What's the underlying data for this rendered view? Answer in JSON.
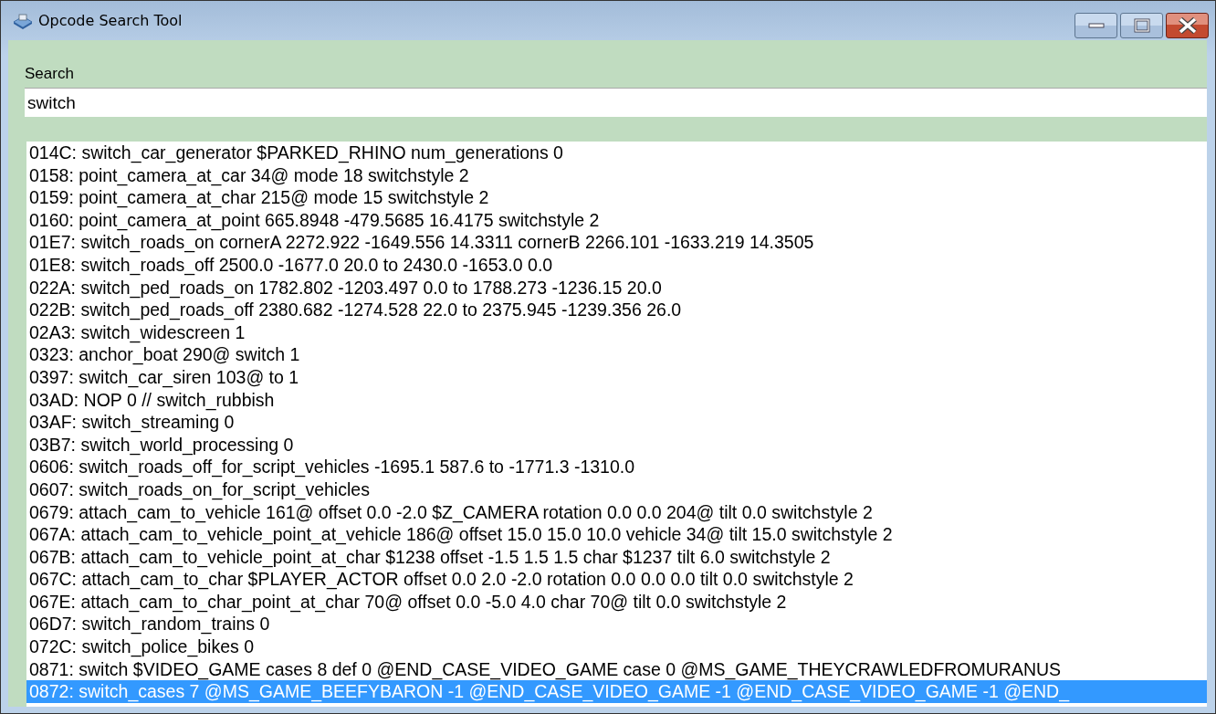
{
  "window": {
    "title": "Opcode Search Tool"
  },
  "search": {
    "label": "Search",
    "value": "switch"
  },
  "results": [
    {
      "text": "014C: switch_car_generator $PARKED_RHINO num_generations 0",
      "selected": false
    },
    {
      "text": "0158: point_camera_at_car 34@ mode 18 switchstyle 2",
      "selected": false
    },
    {
      "text": "0159: point_camera_at_char 215@ mode 15 switchstyle 2",
      "selected": false
    },
    {
      "text": "0160: point_camera_at_point 665.8948 -479.5685 16.4175 switchstyle 2",
      "selected": false
    },
    {
      "text": "01E7: switch_roads_on cornerA 2272.922 -1649.556 14.3311 cornerB 2266.101 -1633.219 14.3505",
      "selected": false
    },
    {
      "text": "01E8: switch_roads_off 2500.0 -1677.0 20.0 to 2430.0 -1653.0 0.0",
      "selected": false
    },
    {
      "text": "022A: switch_ped_roads_on 1782.802 -1203.497 0.0 to 1788.273 -1236.15 20.0",
      "selected": false
    },
    {
      "text": "022B: switch_ped_roads_off 2380.682 -1274.528 22.0 to 2375.945 -1239.356 26.0",
      "selected": false
    },
    {
      "text": "02A3: switch_widescreen 1",
      "selected": false
    },
    {
      "text": "0323: anchor_boat 290@ switch 1",
      "selected": false
    },
    {
      "text": "0397: switch_car_siren 103@ to 1",
      "selected": false
    },
    {
      "text": "03AD: NOP 0 // switch_rubbish",
      "selected": false
    },
    {
      "text": "03AF: switch_streaming 0",
      "selected": false
    },
    {
      "text": "03B7: switch_world_processing 0",
      "selected": false
    },
    {
      "text": "0606: switch_roads_off_for_script_vehicles -1695.1 587.6 to -1771.3 -1310.0",
      "selected": false
    },
    {
      "text": "0607: switch_roads_on_for_script_vehicles",
      "selected": false
    },
    {
      "text": "0679: attach_cam_to_vehicle 161@ offset 0.0 -2.0 $Z_CAMERA rotation 0.0 0.0 204@ tilt 0.0 switchstyle 2",
      "selected": false
    },
    {
      "text": "067A: attach_cam_to_vehicle_point_at_vehicle 186@ offset 15.0 15.0 10.0 vehicle 34@ tilt 15.0 switchstyle 2",
      "selected": false
    },
    {
      "text": "067B: attach_cam_to_vehicle_point_at_char $1238 offset -1.5 1.5 1.5 char $1237 tilt 6.0 switchstyle 2",
      "selected": false
    },
    {
      "text": "067C: attach_cam_to_char $PLAYER_ACTOR offset 0.0 2.0 -2.0 rotation 0.0 0.0 0.0 tilt 0.0 switchstyle 2",
      "selected": false
    },
    {
      "text": "067E: attach_cam_to_char_point_at_char 70@ offset 0.0 -5.0 4.0 char 70@ tilt 0.0 switchstyle 2",
      "selected": false
    },
    {
      "text": "06D7: switch_random_trains 0",
      "selected": false
    },
    {
      "text": "072C: switch_police_bikes 0",
      "selected": false
    },
    {
      "text": "0871: switch $VIDEO_GAME cases 8 def 0 @END_CASE_VIDEO_GAME case 0 @MS_GAME_THEYCRAWLEDFROMURANUS",
      "selected": false
    },
    {
      "text": "0872: switch_cases 7 @MS_GAME_BEEFYBARON -1 @END_CASE_VIDEO_GAME -1 @END_CASE_VIDEO_GAME -1 @END_",
      "selected": true
    }
  ]
}
